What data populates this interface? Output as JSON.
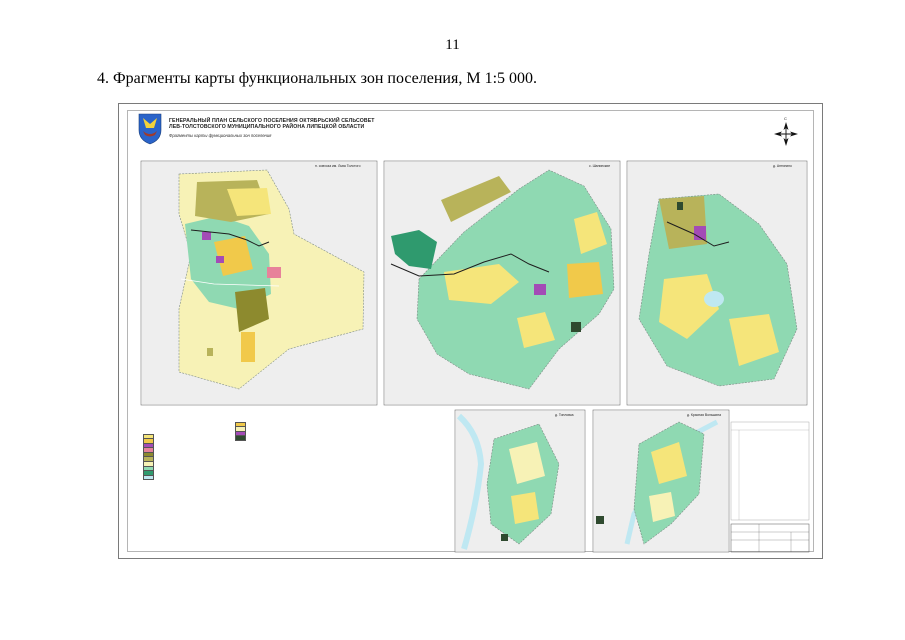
{
  "page": {
    "number": "11",
    "heading": "4. Фрагменты карты функциональных зон поселения, М 1:5 000."
  },
  "sheet": {
    "title_lines": [
      "ГЕНЕРАЛЬНЫЙ ПЛАН СЕЛЬСКОГО ПОСЕЛЕНИЯ ОКТЯБРЬСКИЙ СЕЛЬСОВЕТ",
      "ЛЕВ-ТОЛСТОВСКОГО МУНИЦИПАЛЬНОГО РАЙОНА ЛИПЕЦКОЙ ОБЛАСТИ"
    ],
    "subtitle": "Фрагменты карты функциональных зон поселения",
    "north_letter": "С",
    "panels": [
      {
        "label": "п. совхоза им. Льва Толстого"
      },
      {
        "label": "с. Шанинские"
      },
      {
        "label": "д. Антипино"
      },
      {
        "label": "д. Топловка"
      },
      {
        "label": "д. Красная Вольшина"
      }
    ],
    "colors": {
      "residential_low": "#f5e57a",
      "residential_mid": "#f1c94a",
      "agricultural": "#f7f2b6",
      "green": "#8fd9b2",
      "green_dark": "#2f9a6e",
      "forest_olive": "#b8b35a",
      "production_olive": "#8d8a2e",
      "social_purple": "#a34bb6",
      "business_pink": "#e7829a",
      "water": "#bfe8f2",
      "road": "#1e1e1e",
      "boundary": "#8aa09a",
      "frame": "#8c8c8c"
    }
  }
}
